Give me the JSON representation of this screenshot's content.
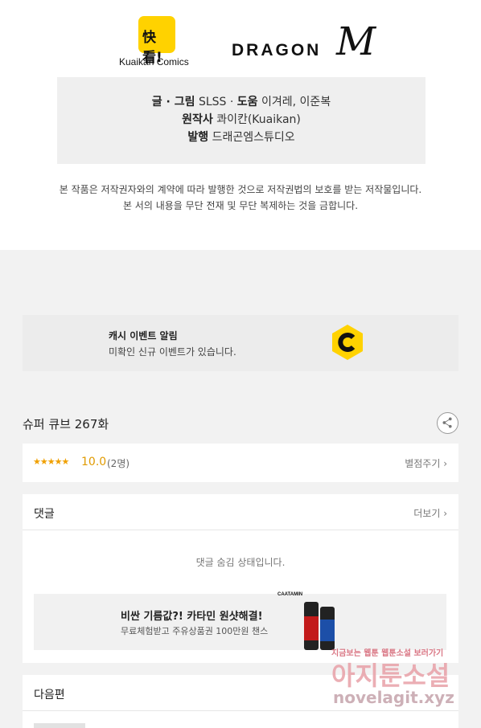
{
  "logos": {
    "kuaikan_mark": "快看!",
    "kuaikan_name": "Kuaikan Comics",
    "dragon_text": "DRAGON",
    "dragon_m": "M"
  },
  "credits": {
    "line1_label1": "글 · 그림",
    "line1_val1": "SLSS",
    "line1_sep": " · ",
    "line1_label2": "도움",
    "line1_val2": "이겨레, 이준복",
    "line2_label": "원작사",
    "line2_val": "콰이칸(Kuaikan)",
    "line3_label": "발행",
    "line3_val": "드래곤엠스튜디오"
  },
  "copyright": {
    "line1": "본 작품은 저작권자와의 계약에 따라 발행한 것으로 저작권법의 보호를 받는 저작물입니다.",
    "line2": "본 서의 내용을 무단 전재 및 무단 복제하는 것을 금합니다."
  },
  "cash_banner": {
    "title": "캐시 이벤트 알림",
    "subtitle": "미확인 신규 이벤트가 있습니다.",
    "icon_color": "#ffd200"
  },
  "episode": {
    "title": "슈퍼 큐브 267화"
  },
  "rating": {
    "stars": "★★★★★",
    "score": "10.0",
    "votes": "(2명)",
    "rate_link": "별점주기 ›"
  },
  "comments": {
    "title": "댓글",
    "more_link": "더보기 ›",
    "hidden_msg": "댓글 숨김 상태입니다."
  },
  "ad": {
    "title": "비싼 기름값?! 카타민 원샷해결!",
    "subtitle": "무료체험받고 주유상품권 100만원 챈스",
    "product_label": "CAATAMIN"
  },
  "next": {
    "title": "다음편"
  },
  "watermark": {
    "top": "지금보는 웹툰 웹툰소설 보러가기",
    "main": "아지툰소설",
    "url": "novelagit.xyz"
  }
}
